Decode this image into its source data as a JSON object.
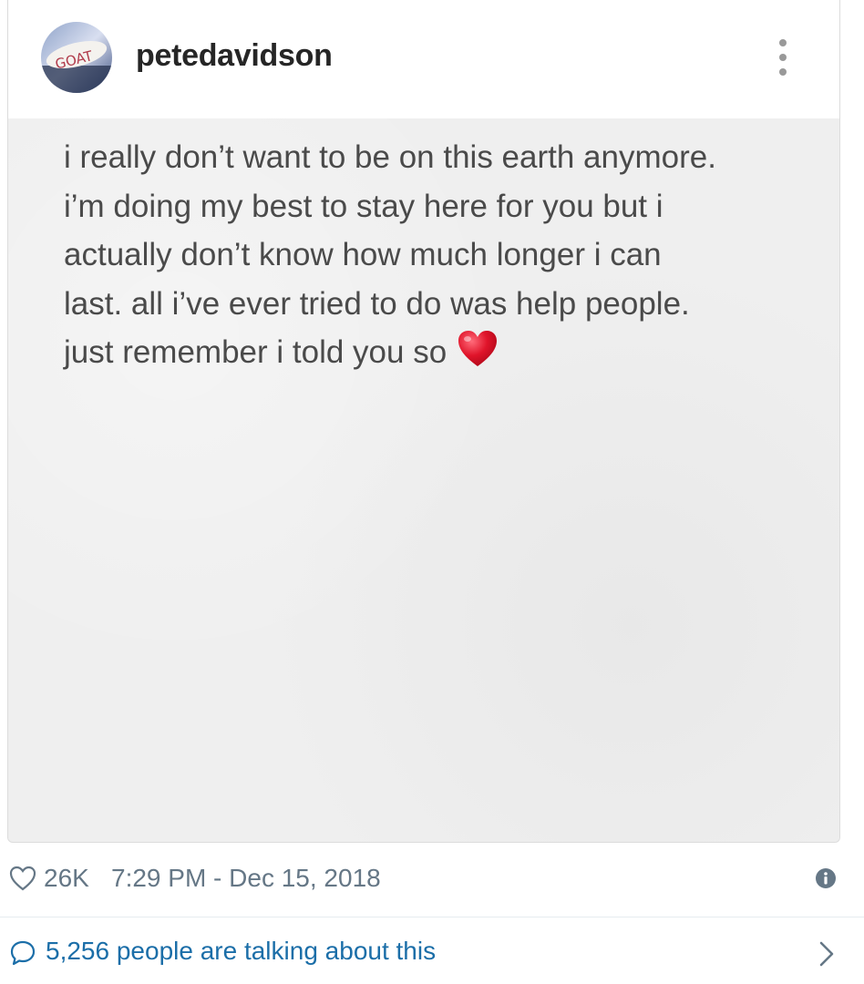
{
  "post": {
    "username": "petedavidson",
    "avatar_text": "GOAT",
    "note_lines": [
      "i really don’t want to be on this earth anymore.",
      "i’m doing my best to stay here for you but i",
      "actually don’t know how much longer i can",
      "last. all i’ve ever tried to do was help people.",
      "just remember i told you so"
    ],
    "emoji": "red-heart"
  },
  "tweet": {
    "like_count": "26K",
    "timestamp": "7:29 PM - Dec 15, 2018",
    "conversation_text": "5,256 people are talking about this"
  },
  "icons": {
    "more": "more-vertical-icon",
    "like": "heart-outline-icon",
    "info": "info-icon",
    "reply": "speech-bubble-icon",
    "chevron": "chevron-right-icon"
  },
  "colors": {
    "meta_gray": "#657786",
    "link_blue": "#1b6ea8",
    "emoji_red": "#e0142a",
    "username": "#262626",
    "note_text": "#4a4a4a"
  }
}
